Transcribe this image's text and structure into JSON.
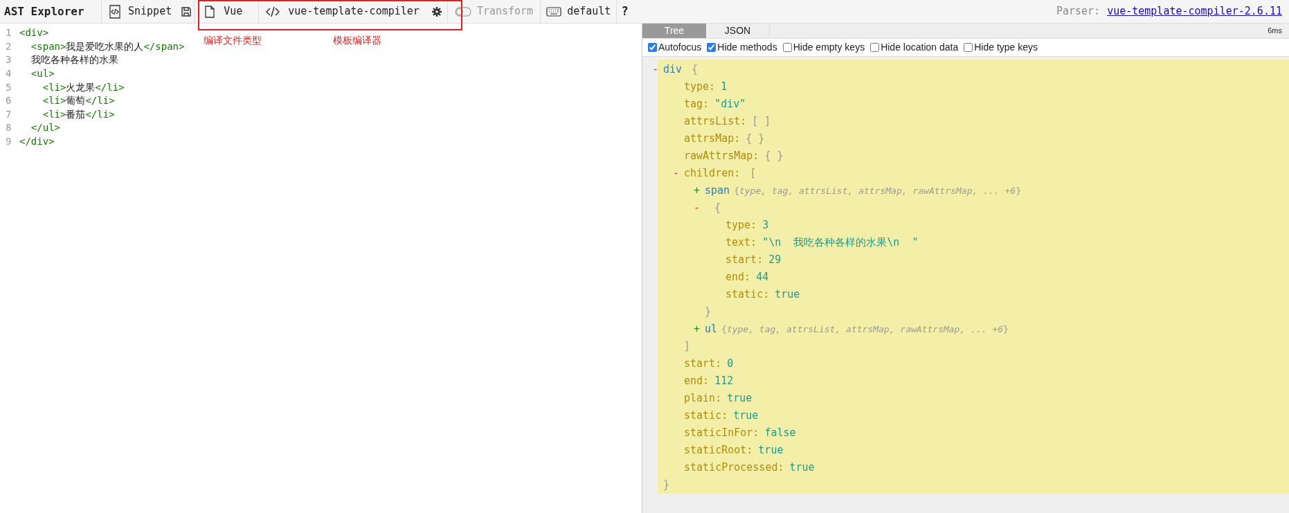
{
  "toolbar": {
    "title": "AST Explorer",
    "snippet": "Snippet",
    "language": "Vue",
    "parser_name": "vue-template-compiler",
    "transform": {
      "label": "Transform",
      "disabled": true
    },
    "keymap": "default",
    "help": "?",
    "parser_label": "Parser:",
    "parser_link": "vue-template-compiler-2.6.11"
  },
  "annotations": {
    "labels": [
      "编译文件类型",
      "模板编译器"
    ]
  },
  "editor": {
    "lines": [
      {
        "number": "1",
        "segments": [
          {
            "kind": "tag",
            "text": "<div>"
          }
        ]
      },
      {
        "number": "2",
        "segments": [
          {
            "kind": "tag",
            "text": "  <span>"
          },
          {
            "kind": "text",
            "text": "我是爱吃水果的人"
          },
          {
            "kind": "tag",
            "text": "</span>"
          }
        ]
      },
      {
        "number": "3",
        "segments": [
          {
            "kind": "text",
            "text": "  我吃各种各样的水果"
          }
        ]
      },
      {
        "number": "4",
        "segments": [
          {
            "kind": "tag",
            "text": "  <ul>"
          }
        ]
      },
      {
        "number": "5",
        "segments": [
          {
            "kind": "tag",
            "text": "    <li>"
          },
          {
            "kind": "text",
            "text": "火龙果"
          },
          {
            "kind": "tag",
            "text": "</li>"
          }
        ]
      },
      {
        "number": "6",
        "segments": [
          {
            "kind": "tag",
            "text": "    <li>"
          },
          {
            "kind": "text",
            "text": "葡萄"
          },
          {
            "kind": "tag",
            "text": "</li>"
          }
        ]
      },
      {
        "number": "7",
        "segments": [
          {
            "kind": "tag",
            "text": "    <li>"
          },
          {
            "kind": "text",
            "text": "番茄"
          },
          {
            "kind": "tag",
            "text": "</li>"
          }
        ]
      },
      {
        "number": "8",
        "segments": [
          {
            "kind": "tag",
            "text": "  </ul>"
          }
        ]
      },
      {
        "number": "9",
        "segments": [
          {
            "kind": "tag",
            "text": "</div>"
          }
        ]
      }
    ]
  },
  "output": {
    "tabs": [
      {
        "label": "Tree",
        "selected": true
      },
      {
        "label": "JSON",
        "selected": false
      }
    ],
    "timing": "6ms",
    "options": [
      {
        "label": "Autofocus",
        "checked": true
      },
      {
        "label": "Hide methods",
        "checked": true
      },
      {
        "label": "Hide empty keys",
        "checked": false
      },
      {
        "label": "Hide location data",
        "checked": false
      },
      {
        "label": "Hide type keys",
        "checked": false
      }
    ],
    "tree": {
      "kind": "node",
      "toggle": "-",
      "expanded": true,
      "label": "div",
      "open": "{",
      "close": "}",
      "children": [
        {
          "kind": "prop",
          "key": "type:",
          "value": "1",
          "empty": false
        },
        {
          "kind": "prop",
          "key": "tag:",
          "value": "\"div\"",
          "empty": false
        },
        {
          "kind": "prop",
          "key": "attrsList:",
          "value": "[ ]",
          "empty": true
        },
        {
          "kind": "prop",
          "key": "attrsMap:",
          "value": "{ }",
          "empty": true
        },
        {
          "kind": "prop",
          "key": "rawAttrsMap:",
          "value": "{ }",
          "empty": true
        },
        {
          "kind": "node",
          "toggle": "-",
          "expanded": true,
          "key": "children:",
          "open": "[",
          "close": "]",
          "children": [
            {
              "kind": "node",
              "toggle": "+",
              "expanded": false,
              "label": "span",
              "summary": "{*type, tag, attrsList, attrsMap, rawAttrsMap, ... +6*}"
            },
            {
              "kind": "node",
              "toggle": "-",
              "expanded": true,
              "open": "{",
              "close": "}",
              "children": [
                {
                  "kind": "prop",
                  "key": "type:",
                  "value": "3",
                  "empty": false
                },
                {
                  "kind": "prop",
                  "key": "text:",
                  "value": "\"\\n  我吃各种各样的水果\\n  \"",
                  "empty": false
                },
                {
                  "kind": "prop",
                  "key": "start:",
                  "value": "29",
                  "empty": false
                },
                {
                  "kind": "prop",
                  "key": "end:",
                  "value": "44",
                  "empty": false
                },
                {
                  "kind": "prop",
                  "key": "static:",
                  "value": "true",
                  "empty": false
                }
              ]
            },
            {
              "kind": "node",
              "toggle": "+",
              "expanded": false,
              "label": "ul",
              "summary": "{*type, tag, attrsList, attrsMap, rawAttrsMap, ... +6*}"
            }
          ]
        },
        {
          "kind": "prop",
          "key": "start:",
          "value": "0",
          "empty": false
        },
        {
          "kind": "prop",
          "key": "end:",
          "value": "112",
          "empty": false
        },
        {
          "kind": "prop",
          "key": "plain:",
          "value": "true",
          "empty": false
        },
        {
          "kind": "prop",
          "key": "static:",
          "value": "true",
          "empty": false
        },
        {
          "kind": "prop",
          "key": "staticInFor:",
          "value": "false",
          "empty": false
        },
        {
          "kind": "prop",
          "key": "staticRoot:",
          "value": "true",
          "empty": false
        },
        {
          "kind": "prop",
          "key": "staticProcessed:",
          "value": "true",
          "empty": false
        }
      ]
    }
  }
}
